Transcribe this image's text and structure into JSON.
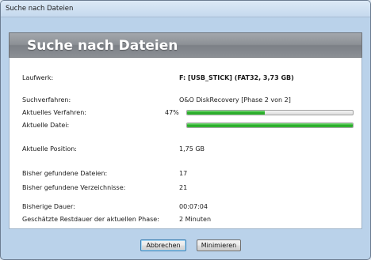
{
  "window": {
    "title": "Suche nach Dateien"
  },
  "header": {
    "title": "Suche nach Dateien"
  },
  "details": {
    "drive_label": "Laufwerk:",
    "drive_value": "F: [USB_STICK] (FAT32, 3,73 GB)",
    "method_label": "Suchverfahren:",
    "method_value": "O&O DiskRecovery [Phase 2 von 2]",
    "current_method_label": "Aktuelles Verfahren:",
    "current_method_percent_text": "47%",
    "current_method_progress": 0.47,
    "current_file_label": "Aktuelle Datei:",
    "current_file_progress": 1.0,
    "position_label": "Aktuelle Position:",
    "position_value": "1,75 GB",
    "found_files_label": "Bisher gefundene Dateien:",
    "found_files_value": "17",
    "found_dirs_label": "Bisher gefundene Verzeichnisse:",
    "found_dirs_value": "21",
    "duration_label": "Bisherige Dauer:",
    "duration_value": "00:07:04",
    "remaining_label": "Geschätzte Restdauer der aktuellen Phase:",
    "remaining_value": "2 Minuten"
  },
  "buttons": {
    "cancel_label": "Abbrechen",
    "minimize_label": "Minimieren"
  },
  "colors": {
    "progress_green": "#2fb52f",
    "header_gray": "#8c9095"
  }
}
